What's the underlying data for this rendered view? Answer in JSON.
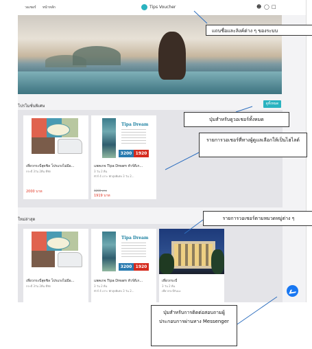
{
  "header": {
    "nav_links": [
      "วอเชอร์",
      "หน้าหลัก"
    ],
    "brand_name": "Tips Voucher",
    "icons": [
      "user-icon",
      "cart-icon",
      "bag-icon"
    ]
  },
  "sections": {
    "promo_title": "โปรโมชั่นพิเศษ",
    "view_all_label": "ดูทั้งหมด",
    "latest_title": "ใหม่ล่าสุด"
  },
  "promo_cards": [
    {
      "title": "เที่ยวกระบี่สุดชิล โปรแรงไม่มีอ...",
      "sub": "กระบี่ 3วัน 2คืน ที่พัก",
      "price": "2000 บาท",
      "old_price": ""
    },
    {
      "title": "แพคเกจ Tipa Dream ทัวร์ดีเก...",
      "sub": "3 วัน 2 คืน",
      "sub2": "ทัวร์ 4 เกาะ พักสุดพิเศษ 3 วัน 2...",
      "old_price": "3200 บาท",
      "price": "1919 บาท"
    }
  ],
  "latest_cards": [
    {
      "title": "เที่ยวกระบี่สุดชิล โปรแรงไม่มีอ...",
      "sub": "กระบี่ 3วัน 2คืน ที่พัก"
    },
    {
      "title": "แพคเกจ Tipa Dream ทัวร์ดีเก...",
      "sub": "3 วัน 2 คืน",
      "sub2": "ทัวร์ 4 เกาะ พักสุดพิเศษ 3 วัน 2..."
    },
    {
      "title": "เที่ยวกระบี่",
      "sub": "3 วัน 2 คืน",
      "sub2": "เที่ยวกระบี่กันนะ"
    }
  ],
  "image_text": {
    "tipa_title": "Tipa Dream",
    "price_old": "3200",
    "price_new": "1920"
  },
  "annotations": {
    "header": "แถบชื่อและลิงค์ต่าง ๆ ของระบบ",
    "view_all": "ปุ่มสำหรับดูวอเชอร์ทั้งหมด",
    "highlight": "รายการวอเชอร์ที่ทางผู้ดูแลเลือกให้เป็นไฮไลต์",
    "category": "รายการวอเชอร์ตามหมวดหมู่ต่าง ๆ",
    "messenger": "ปุ่มสำหรับการติดต่อสอบถามผู้ประกอบการผ่านทาง Messenger"
  },
  "colors": {
    "accent": "#2bb3c0",
    "price": "#e0301e",
    "messenger": "#1877f2"
  }
}
